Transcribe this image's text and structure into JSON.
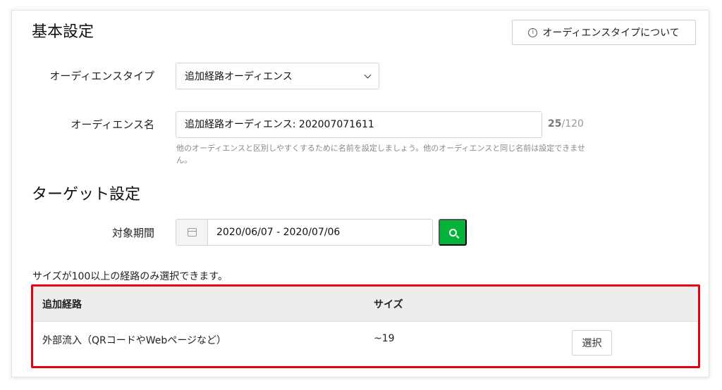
{
  "basic": {
    "title": "基本設定",
    "info_button_label": "オーディエンスタイプについて",
    "audience_type_label": "オーディエンスタイプ",
    "audience_type_value": "追加経路オーディエンス",
    "audience_name_label": "オーディエンス名",
    "audience_name_value": "追加経路オーディエンス: 202007071611",
    "counter_current": "25",
    "counter_max": "/120",
    "help_text": "他のオーディエンスと区別しやすくするために名前を設定しましょう。他のオーディエンスと同じ名前は設定できません。"
  },
  "target": {
    "title": "ターゲット設定",
    "period_label": "対象期間",
    "period_value": "2020/06/07 - 2020/07/06",
    "note": "サイズが100以上の経路のみ選択できます。"
  },
  "table": {
    "headers": [
      "追加経路",
      "サイズ"
    ],
    "rows": [
      {
        "route": "外部流入（QRコードやWebページなど）",
        "size": "~19",
        "action": "選択"
      }
    ]
  },
  "colors": {
    "accent": "#06b33a",
    "highlight": "#e60012"
  }
}
